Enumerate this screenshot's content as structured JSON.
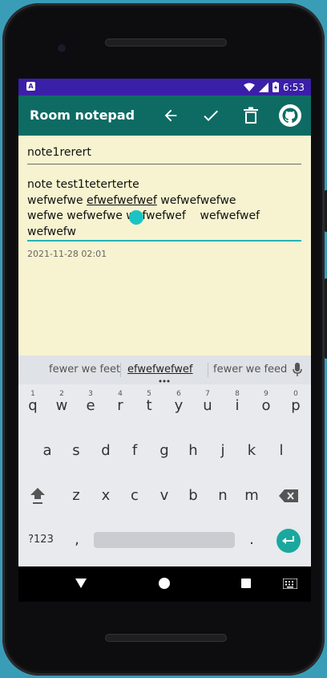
{
  "status": {
    "left_icon": "A",
    "time": "6:53",
    "icons": [
      "wifi-icon",
      "signal-icon",
      "battery-charging-icon"
    ]
  },
  "appbar": {
    "title": "Room notepad",
    "icons": [
      "back-arrow-icon",
      "check-icon",
      "trash-icon",
      "github-icon"
    ]
  },
  "note": {
    "title": "note1rerert",
    "body_line1": "note test1teterterte",
    "body_line2_a": "wefwefwe ",
    "body_line2_b": "efwefwefwef",
    "body_line2_c": " wefwefwefwe",
    "body_line3": "wefwe wefwefwe wefwefwef    wefwefwef",
    "body_line4": "wefwefw",
    "date": "2021-11-28 02:01"
  },
  "keyboard": {
    "suggestions": [
      "fewer we feet",
      "efwefwefwef",
      "fewer we feed"
    ],
    "row1": [
      "q",
      "w",
      "e",
      "r",
      "t",
      "y",
      "u",
      "i",
      "o",
      "p"
    ],
    "row1_nums": [
      "1",
      "2",
      "3",
      "4",
      "5",
      "6",
      "7",
      "8",
      "9",
      "0"
    ],
    "row2": [
      "a",
      "s",
      "d",
      "f",
      "g",
      "h",
      "j",
      "k",
      "l"
    ],
    "row3": [
      "z",
      "x",
      "c",
      "v",
      "b",
      "n",
      "m"
    ],
    "row4": {
      "symbols": "?123",
      "comma": ",",
      "period": "."
    }
  },
  "colors": {
    "status_bar": "#3a1fa8",
    "app_bar": "#0e6b63",
    "note_background": "#f7f3d0",
    "accent": "#26b3b8"
  }
}
